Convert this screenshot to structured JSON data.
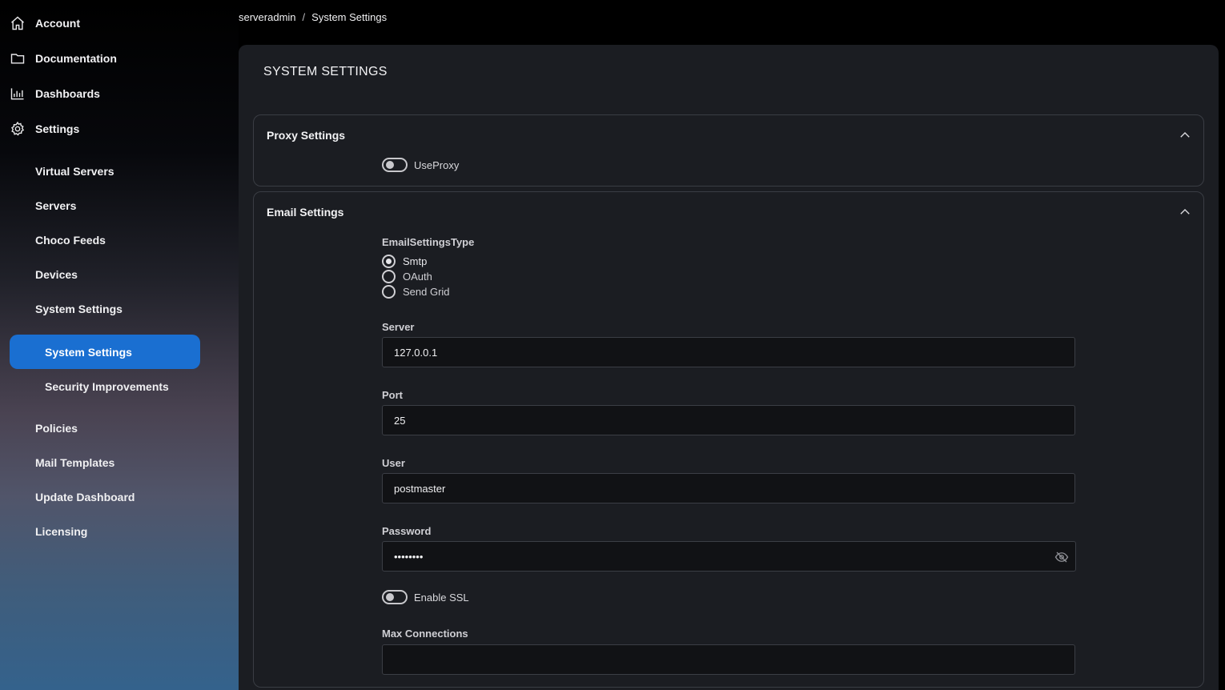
{
  "sidebar": {
    "top_items": [
      {
        "label": "Account",
        "icon": "home-icon"
      },
      {
        "label": "Documentation",
        "icon": "folder-icon"
      },
      {
        "label": "Dashboards",
        "icon": "bar-chart-icon"
      },
      {
        "label": "Settings",
        "icon": "gear-icon"
      }
    ],
    "settings_items": [
      {
        "label": "Virtual Servers"
      },
      {
        "label": "Servers"
      },
      {
        "label": "Choco Feeds"
      },
      {
        "label": "Devices"
      },
      {
        "label": "System Settings"
      }
    ],
    "system_settings_items": [
      {
        "label": "System Settings",
        "active": true
      },
      {
        "label": "Security Improvements",
        "active": false
      }
    ],
    "bottom_items": [
      {
        "label": "Policies"
      },
      {
        "label": "Mail Templates"
      },
      {
        "label": "Update Dashboard"
      },
      {
        "label": "Licensing"
      }
    ]
  },
  "breadcrumb": {
    "root": "serveradmin",
    "separator": "/",
    "current": "System Settings"
  },
  "main": {
    "title": "SYSTEM SETTINGS",
    "proxy": {
      "title": "Proxy Settings",
      "use_proxy_label": "UseProxy"
    },
    "email": {
      "title": "Email Settings",
      "type_label": "EmailSettingsType",
      "type_options": [
        {
          "label": "Smtp",
          "selected": true
        },
        {
          "label": "OAuth",
          "selected": false
        },
        {
          "label": "Send Grid",
          "selected": false
        }
      ],
      "server_label": "Server",
      "server_value": "127.0.0.1",
      "port_label": "Port",
      "port_value": "25",
      "user_label": "User",
      "user_value": "postmaster",
      "password_label": "Password",
      "password_value": "••••••••",
      "enable_ssl_label": "Enable SSL",
      "max_connections_label": "Max Connections",
      "max_connections_value": ""
    }
  },
  "colors": {
    "active_nav": "#1a6fd1",
    "panel_bg": "#1b1d22",
    "input_bg": "#111215"
  }
}
